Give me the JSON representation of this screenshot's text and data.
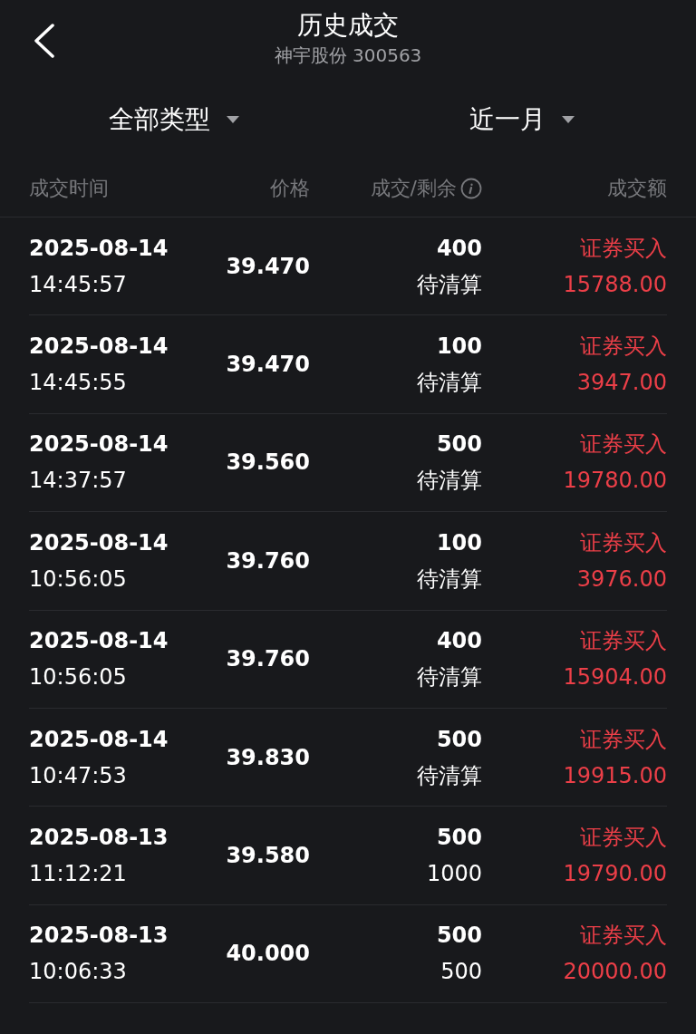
{
  "header": {
    "title": "历史成交",
    "subtitle": "神宇股份 300563"
  },
  "filters": [
    {
      "label": "全部类型"
    },
    {
      "label": "近一月"
    }
  ],
  "columns": [
    "成交时间",
    "价格",
    "成交/剩余",
    "成交额"
  ],
  "rows": [
    {
      "date": "2025-08-14",
      "time": "14:45:57",
      "price": "39.470",
      "filled": "400",
      "remaining": "待清算",
      "side": "证券买入",
      "amount": "15788.00"
    },
    {
      "date": "2025-08-14",
      "time": "14:45:55",
      "price": "39.470",
      "filled": "100",
      "remaining": "待清算",
      "side": "证券买入",
      "amount": "3947.00"
    },
    {
      "date": "2025-08-14",
      "time": "14:37:57",
      "price": "39.560",
      "filled": "500",
      "remaining": "待清算",
      "side": "证券买入",
      "amount": "19780.00"
    },
    {
      "date": "2025-08-14",
      "time": "10:56:05",
      "price": "39.760",
      "filled": "100",
      "remaining": "待清算",
      "side": "证券买入",
      "amount": "3976.00"
    },
    {
      "date": "2025-08-14",
      "time": "10:56:05",
      "price": "39.760",
      "filled": "400",
      "remaining": "待清算",
      "side": "证券买入",
      "amount": "15904.00"
    },
    {
      "date": "2025-08-14",
      "time": "10:47:53",
      "price": "39.830",
      "filled": "500",
      "remaining": "待清算",
      "side": "证券买入",
      "amount": "19915.00"
    },
    {
      "date": "2025-08-13",
      "time": "11:12:21",
      "price": "39.580",
      "filled": "500",
      "remaining": "1000",
      "side": "证券买入",
      "amount": "19790.00"
    },
    {
      "date": "2025-08-13",
      "time": "10:06:33",
      "price": "40.000",
      "filled": "500",
      "remaining": "500",
      "side": "证券买入",
      "amount": "20000.00"
    }
  ]
}
